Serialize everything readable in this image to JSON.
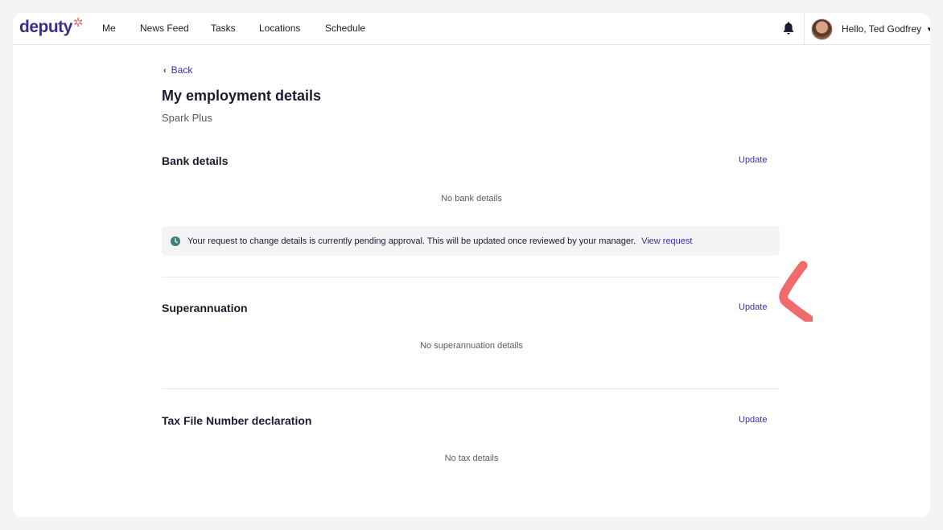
{
  "nav": {
    "logo_text": "deputy",
    "logo_mark": "✲",
    "items": [
      "Me",
      "News Feed",
      "Tasks",
      "Locations",
      "Schedule"
    ],
    "user_greeting": "Hello, Ted Godfrey"
  },
  "page": {
    "back_label": "Back",
    "title": "My employment details",
    "subtitle": "Spark Plus"
  },
  "sections": {
    "bank": {
      "title": "Bank details",
      "update_label": "Update",
      "empty_text": "No bank details",
      "notice_text": "Your request to change details is currently pending approval. This will be updated once reviewed by your manager.",
      "notice_link": "View request"
    },
    "super": {
      "title": "Superannuation",
      "update_label": "Update",
      "empty_text": "No superannuation details"
    },
    "tax": {
      "title": "Tax File Number declaration",
      "update_label": "Update",
      "empty_text": "No tax details"
    }
  },
  "colors": {
    "brand": "#3a2e8a",
    "link": "#3a2ea8",
    "accent": "#f26b6b",
    "notice_icon": "#3d7f7a"
  },
  "icons": {
    "back": "chevron-left-icon",
    "bell": "bell-icon",
    "caret": "caret-down-icon",
    "notice": "clock-icon"
  }
}
